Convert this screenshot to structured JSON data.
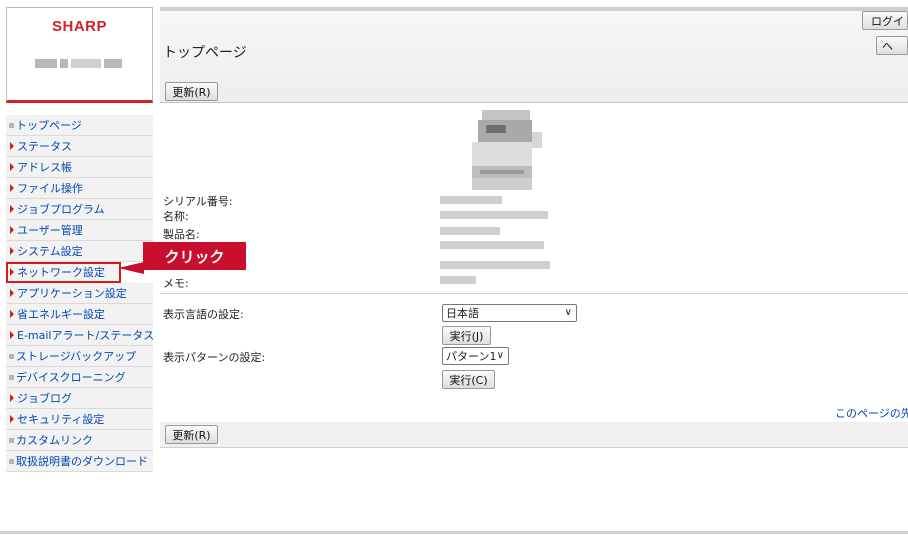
{
  "brand": "SHARP",
  "nav": [
    {
      "label": "トップページ",
      "marker": "gray"
    },
    {
      "label": "ステータス",
      "marker": "red"
    },
    {
      "label": "アドレス帳",
      "marker": "red"
    },
    {
      "label": "ファイル操作",
      "marker": "red"
    },
    {
      "label": "ジョブプログラム",
      "marker": "red"
    },
    {
      "label": "ユーザー管理",
      "marker": "red"
    },
    {
      "label": "システム設定",
      "marker": "red"
    },
    {
      "label": "ネットワーク設定",
      "marker": "red",
      "highlighted": true
    },
    {
      "label": "アプリケーション設定",
      "marker": "red"
    },
    {
      "label": "省エネルギー設定",
      "marker": "red"
    },
    {
      "label": "E-mailアラート/ステータス",
      "marker": "red"
    },
    {
      "label": "ストレージバックアップ",
      "marker": "gray"
    },
    {
      "label": "デバイスクローニング",
      "marker": "gray"
    },
    {
      "label": "ジョブログ",
      "marker": "red"
    },
    {
      "label": "セキュリティ設定",
      "marker": "red"
    },
    {
      "label": "カスタムリンク",
      "marker": "gray"
    },
    {
      "label": "取扱説明書のダウンロード",
      "marker": "gray"
    }
  ],
  "callout": "クリック",
  "header": {
    "title": "トップページ",
    "login_label": "ログイ",
    "help_label": "ヘ",
    "refresh_label": "更新(R)"
  },
  "info": {
    "serial_label": "シリアル番号:",
    "name_label": "名称:",
    "product_label": "製品名:",
    "memo_label": "メモ:"
  },
  "settings": {
    "language_label": "表示言語の設定:",
    "language_value": "日本語",
    "execute_j": "実行(J)",
    "pattern_label": "表示パターンの設定:",
    "pattern_value": "パターン1",
    "execute_c": "実行(C)"
  },
  "footer": {
    "page_link": "このページの先",
    "refresh_label": "更新(R)"
  },
  "colors": {
    "brand_red": "#d3202b",
    "callout_red": "#c8102e",
    "link_blue": "#0047b3"
  }
}
